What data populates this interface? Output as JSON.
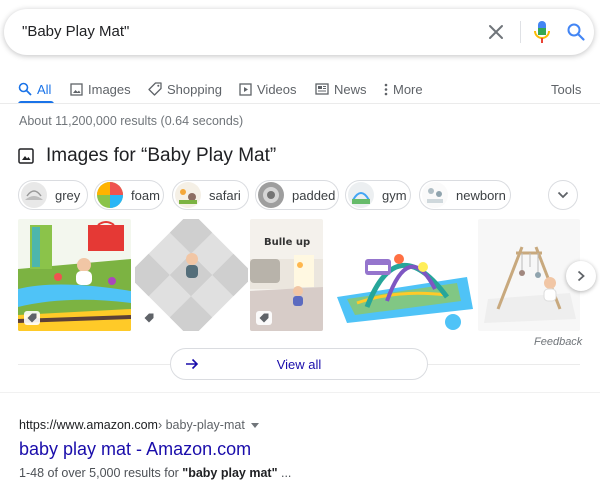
{
  "search": {
    "query": "\"Baby Play Mat\"",
    "clear_icon": "close-icon",
    "mic_icon": "microphone-icon",
    "search_icon": "search-icon"
  },
  "tabs": [
    {
      "label": "All",
      "icon": "search-icon",
      "active": true
    },
    {
      "label": "Images",
      "icon": "image-icon"
    },
    {
      "label": "Shopping",
      "icon": "tag-icon"
    },
    {
      "label": "Videos",
      "icon": "play-icon"
    },
    {
      "label": "News",
      "icon": "newspaper-icon"
    },
    {
      "label": "More",
      "icon": "more-vert-icon"
    }
  ],
  "tools_label": "Tools",
  "result_stats": "About 11,200,000 results (0.64 seconds)",
  "images_section": {
    "title": "Images for “Baby Play Mat”",
    "chips": [
      {
        "label": "grey"
      },
      {
        "label": "foam"
      },
      {
        "label": "safari"
      },
      {
        "label": "padded"
      },
      {
        "label": "gym"
      },
      {
        "label": "newborn"
      }
    ],
    "thumbnail_text": "Bulle up",
    "feedback_label": "Feedback",
    "view_all_label": "View all"
  },
  "result": {
    "url_domain": "https://www.amazon.com",
    "url_path": " › baby-play-mat",
    "title": "baby play mat - Amazon.com",
    "snippet_prefix": "1-48 of over 5,000 results for ",
    "snippet_bold": "\"baby play mat\"",
    "snippet_suffix": " ..."
  },
  "colors": {
    "link_blue": "#1a0dab",
    "accent_blue": "#1a73e8",
    "mic_red": "#ea4335"
  }
}
